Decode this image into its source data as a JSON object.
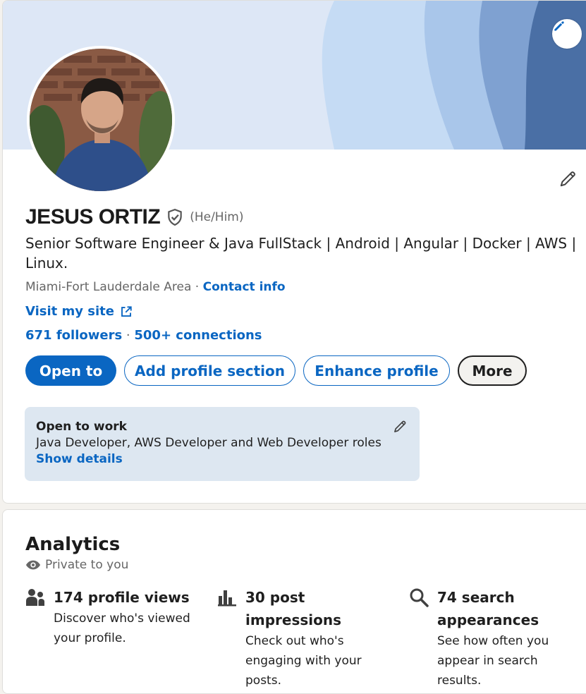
{
  "banner": {
    "edit_icon": "pencil-icon"
  },
  "profile": {
    "name": "JESUS ORTIZ",
    "verified_icon": "shield-check-icon",
    "pronouns": "(He/Him)",
    "headline": "Senior Software Engineer & Java FullStack | Android | Angular | Docker | AWS | Linux.",
    "location": "Miami-Fort Lauderdale Area",
    "separator": "·",
    "contact_info": "Contact info",
    "website": "Visit my site",
    "followers": "671 followers",
    "connections_sep": "·",
    "connections": "500+ connections"
  },
  "actions": {
    "open_to": "Open to",
    "add_section": "Add profile section",
    "enhance": "Enhance profile",
    "more": "More"
  },
  "open_to_work": {
    "title": "Open to work",
    "roles": "Java Developer, AWS Developer and Web Developer roles",
    "show_details": "Show details"
  },
  "analytics": {
    "title": "Analytics",
    "privacy": "Private to you",
    "items": [
      {
        "icon": "people-icon",
        "headline": "174 profile views",
        "description": "Discover who's viewed your profile."
      },
      {
        "icon": "bar-chart-icon",
        "headline": "30 post impressions",
        "description": "Check out who's engaging with your posts."
      },
      {
        "icon": "search-icon",
        "headline": "74 search appearances",
        "description": "See how often you appear in search results."
      }
    ]
  },
  "colors": {
    "brand": "#0a66c2",
    "open_to_work_bg": "#dde7f1",
    "banner_dark": "#4a6fa5"
  }
}
